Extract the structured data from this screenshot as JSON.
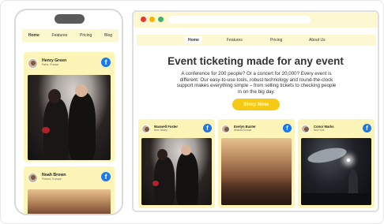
{
  "mobile": {
    "nav": [
      "Home",
      "Features",
      "Pricing",
      "Blog"
    ],
    "cards": [
      {
        "name": "Henry Green",
        "location": "Paris, France"
      },
      {
        "name": "Noah Brown",
        "location": "Poland, Europe"
      }
    ]
  },
  "desktop": {
    "nav": [
      "Home",
      "Features",
      "Pricing",
      "About Us"
    ],
    "hero": {
      "title": "Event ticketing made for any event",
      "body": "A conference for 200 people? Or a concert for 20,000? Every event is different. Our easy-to-use tools, robust technology and round-the-clock support makes everything simple – from selling tickets to checking people in on the big day.",
      "cta": "Shop Now"
    },
    "cards": [
      {
        "name": "Maxwell Foster",
        "location": "New Jersey"
      },
      {
        "name": "Evelyn Baxter",
        "location": "Widows Europe"
      },
      {
        "name": "Conor Marks",
        "location": "New York"
      }
    ]
  },
  "colors": {
    "accent": "#f6c915",
    "card": "#fdf5b8",
    "nav": "#fdf8d2",
    "facebook": "#1877f2"
  },
  "icons": {
    "social": "facebook-icon"
  }
}
